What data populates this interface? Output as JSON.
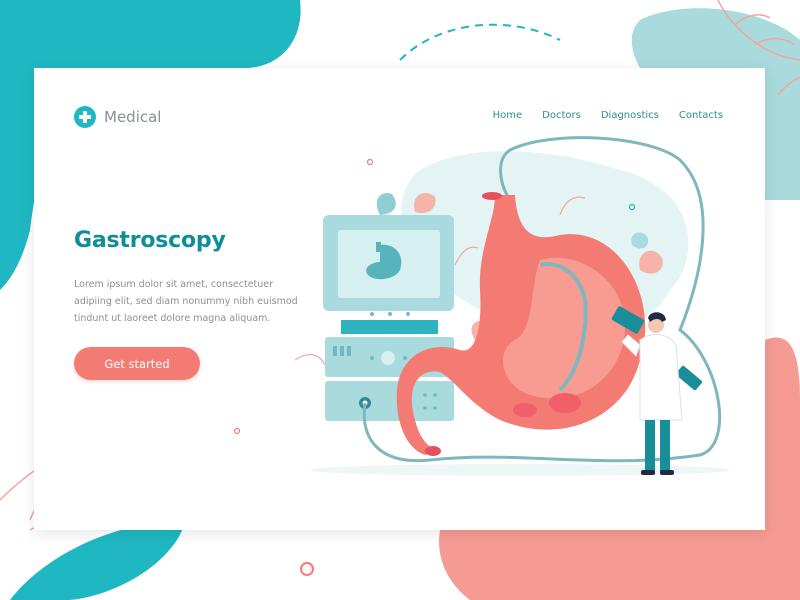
{
  "brand": {
    "name": "Medical",
    "icon": "medical-cross-icon"
  },
  "nav": {
    "items": [
      "Home",
      "Doctors",
      "Diagnostics",
      "Contacts"
    ]
  },
  "hero": {
    "title": "Gastroscopy",
    "text": "Lorem ipsum dolor sit amet, consectetuer adipiing elit, sed diam nonummy nibh euismod tindunt ut laoreet dolore magna aliquam.",
    "cta_label": "Get started"
  },
  "colors": {
    "teal": "#1fb8c2",
    "dark_teal": "#0f8d98",
    "coral": "#f47b74",
    "light_teal": "#a9dadd",
    "text_grey": "#8a8f99"
  }
}
